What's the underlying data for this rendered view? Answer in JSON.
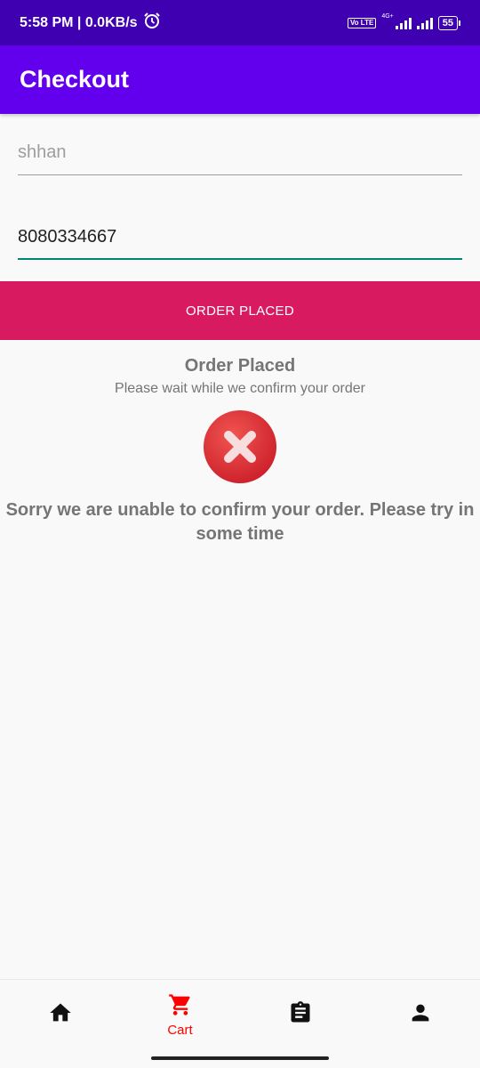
{
  "status_bar": {
    "time_speed": "5:58 PM | 0.0KB/s",
    "volte": "Vo LTE",
    "network": "4G+",
    "battery": "55"
  },
  "app_bar": {
    "title": "Checkout"
  },
  "form": {
    "name_value": "shhan",
    "phone_value": "8080334667"
  },
  "order_button": {
    "label": "ORDER PLACED"
  },
  "order_status": {
    "title": "Order Placed",
    "subtitle": "Please wait while we confirm your order",
    "error_message": "Sorry we are unable to confirm your order. Please try in some time"
  },
  "bottom_nav": {
    "items": [
      {
        "icon": "home-icon",
        "label": ""
      },
      {
        "icon": "cart-icon",
        "label": "Cart",
        "active": true
      },
      {
        "icon": "clipboard-icon",
        "label": ""
      },
      {
        "icon": "person-icon",
        "label": ""
      }
    ],
    "active_color": "#ff0000"
  },
  "colors": {
    "status_bar": "#3e00b0",
    "app_bar": "#6200ee",
    "button": "#d81b60",
    "error": "#e53935",
    "focus_underline": "#008577"
  }
}
